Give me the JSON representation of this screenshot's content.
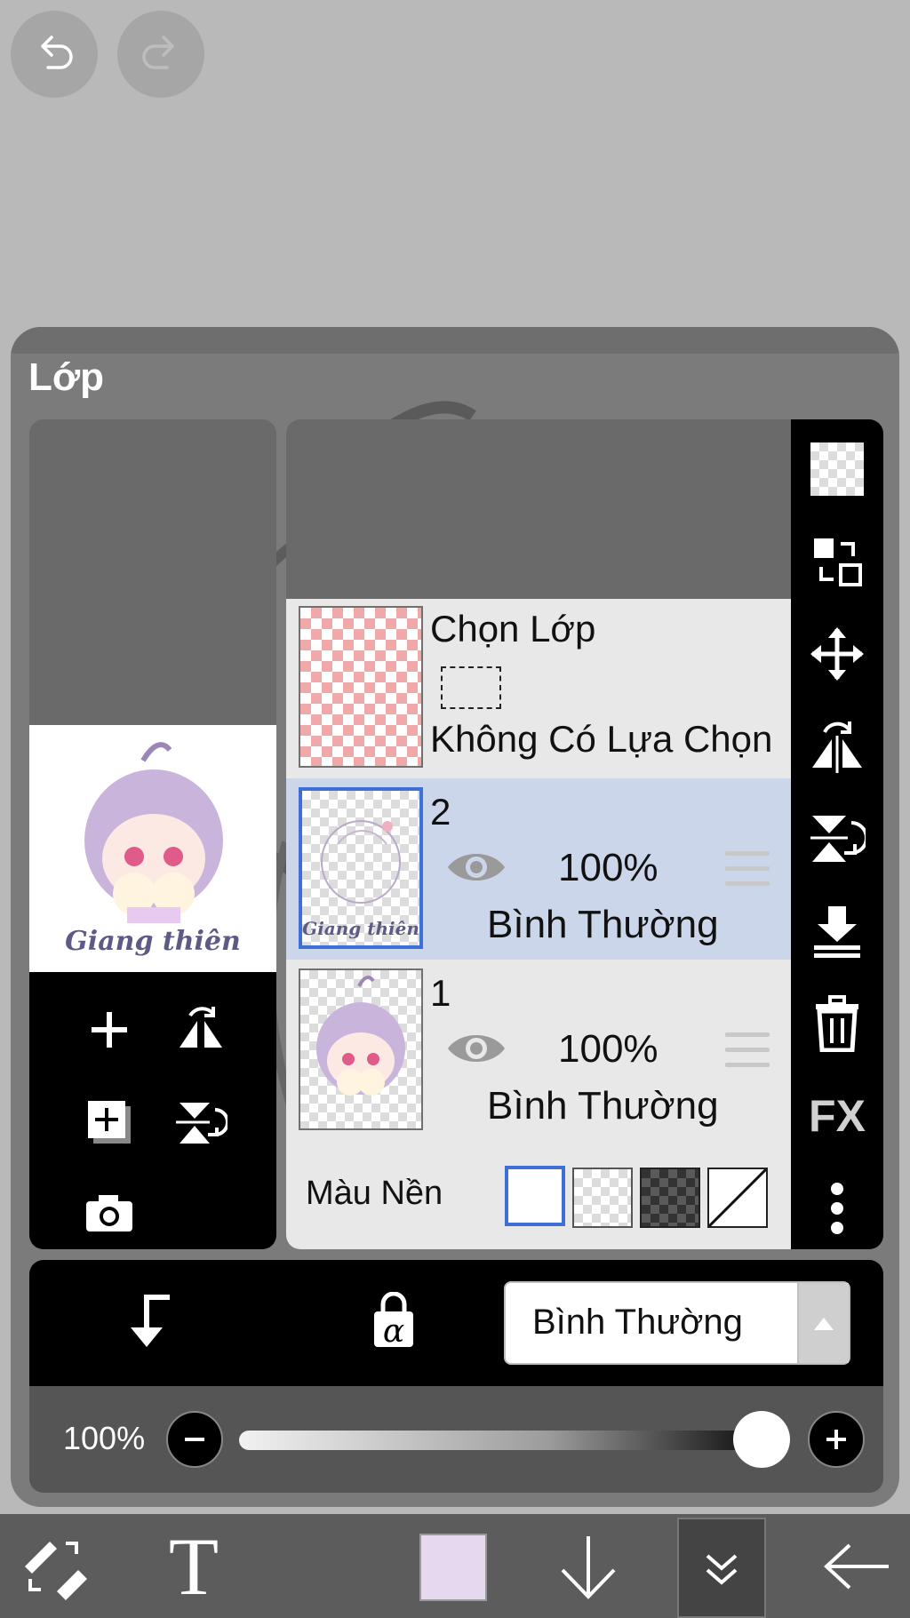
{
  "panel": {
    "title": "Lớp"
  },
  "selection_layer": {
    "title": "Chọn Lớp",
    "status": "Không Có Lựa Chọn"
  },
  "layers": [
    {
      "name": "2",
      "opacity": "100%",
      "blend": "Bình Thường",
      "selected": true
    },
    {
      "name": "1",
      "opacity": "100%",
      "blend": "Bình Thường",
      "selected": false
    }
  ],
  "background": {
    "label": "Màu Nền",
    "options": [
      "white",
      "checker-light",
      "checker-dark",
      "none"
    ],
    "selected": "white"
  },
  "blend_mode": {
    "value": "Bình Thường"
  },
  "opacity": {
    "label": "100%",
    "value": 1.0
  },
  "preview": {
    "watermark": "Giang thiên"
  },
  "colors": {
    "accent": "#3d6fd4",
    "selected_row": "#ccd6ea",
    "current_color": "#e6d9ef"
  },
  "icons": {
    "undo": "undo-icon",
    "redo": "redo-icon",
    "right_bar": [
      "transparency-icon",
      "swap-layers-icon",
      "move-icon",
      "flip-horizontal-icon",
      "flip-vertical-icon",
      "merge-down-icon",
      "trash-icon",
      "fx-icon",
      "more-icon"
    ],
    "left_tools": [
      "add-layer-icon",
      "flip-icon",
      "add-copy-icon",
      "flip-vertical-icon",
      "camera-icon"
    ]
  },
  "right_bar": {
    "fx_label": "FX"
  },
  "bottom_controls": {
    "clip_icon": "clip-arrow-icon",
    "lock_label": "α"
  },
  "toolbar": {
    "text_tool_label": "T"
  }
}
